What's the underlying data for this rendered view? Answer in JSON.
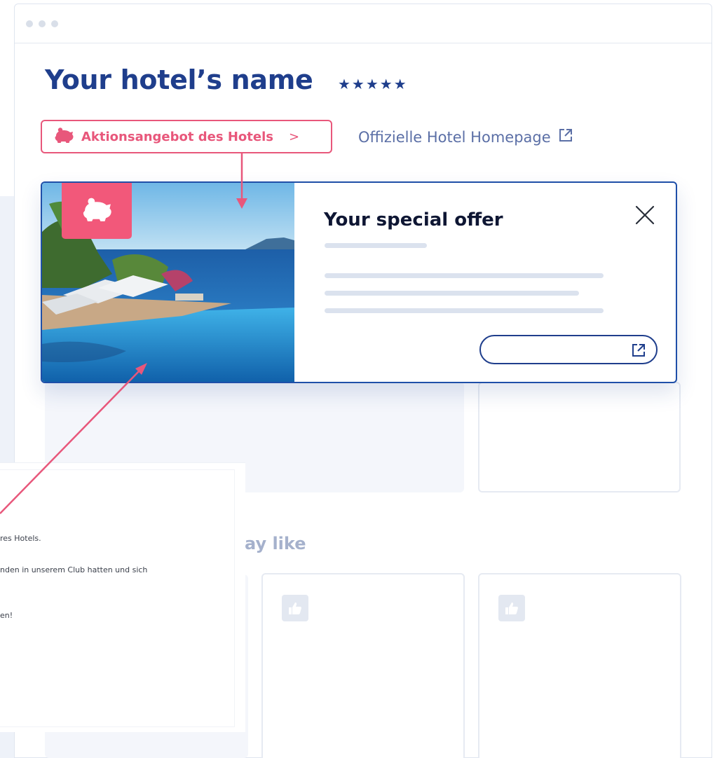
{
  "hotel": {
    "name": "Your hotel’s name",
    "stars": "★★★★★"
  },
  "offer_button": {
    "label": "Aktionsangebot des Hotels",
    "chevron": ">",
    "icon": "piggy-bank-icon"
  },
  "homepage_link": {
    "label": "Offizielle Hotel Homepage",
    "icon": "external-link-icon"
  },
  "offer_card": {
    "title": "Your special offer",
    "close_icon": "close-icon",
    "badge_icon": "piggy-bank-icon",
    "link_icon": "external-link-icon"
  },
  "recommendations": {
    "heading": "ay like",
    "card_icon": "thumbs-up-icon"
  },
  "text_panel": {
    "lines": [
      "res Hotels.",
      "nden in unserem Club hatten und sich",
      "en!"
    ]
  },
  "colors": {
    "brand_blue": "#1f3e8c",
    "accent_pink": "#e8577b",
    "card_border": "#1f4fa8",
    "skeleton": "#dbe2ee"
  }
}
